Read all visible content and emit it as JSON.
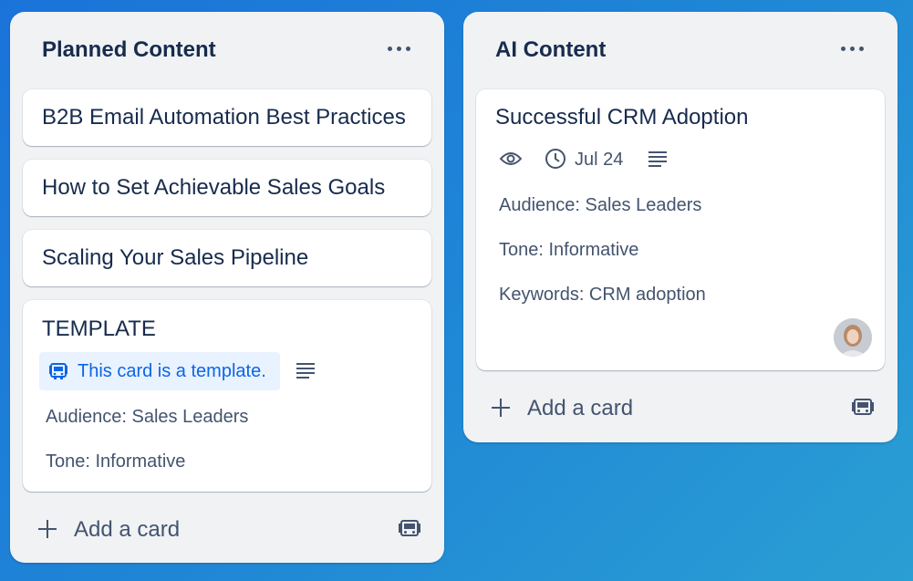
{
  "lists": {
    "planned": {
      "title": "Planned Content",
      "cards": {
        "c1": "B2B Email Automation Best Practices",
        "c2": "How to Set Achievable Sales Goals",
        "c3": "Scaling Your Sales Pipeline",
        "template": {
          "title": "TEMPLATE",
          "badge": "This card is a template.",
          "audience": "Audience: Sales Leaders",
          "tone": "Tone: Informative"
        }
      },
      "add_card": "Add a card"
    },
    "ai": {
      "title": "AI Content",
      "card": {
        "title": "Successful CRM Adoption",
        "due": "Jul 24",
        "audience": "Audience: Sales Leaders",
        "tone": "Tone: Informative",
        "keywords": "Keywords: CRM adoption"
      },
      "add_card": "Add a card"
    }
  },
  "colors": {
    "background": "#1f86d6",
    "list_bg": "#f1f2f4",
    "card_bg": "#ffffff",
    "text": "#172b4d",
    "subtle_text": "#44546f",
    "template_badge_bg": "#e9f2ff",
    "template_badge_text": "#0c66e4"
  },
  "icons": [
    "more-icon",
    "watch-icon",
    "clock-icon",
    "description-icon",
    "template-icon",
    "plus-icon",
    "create-from-template-icon"
  ]
}
